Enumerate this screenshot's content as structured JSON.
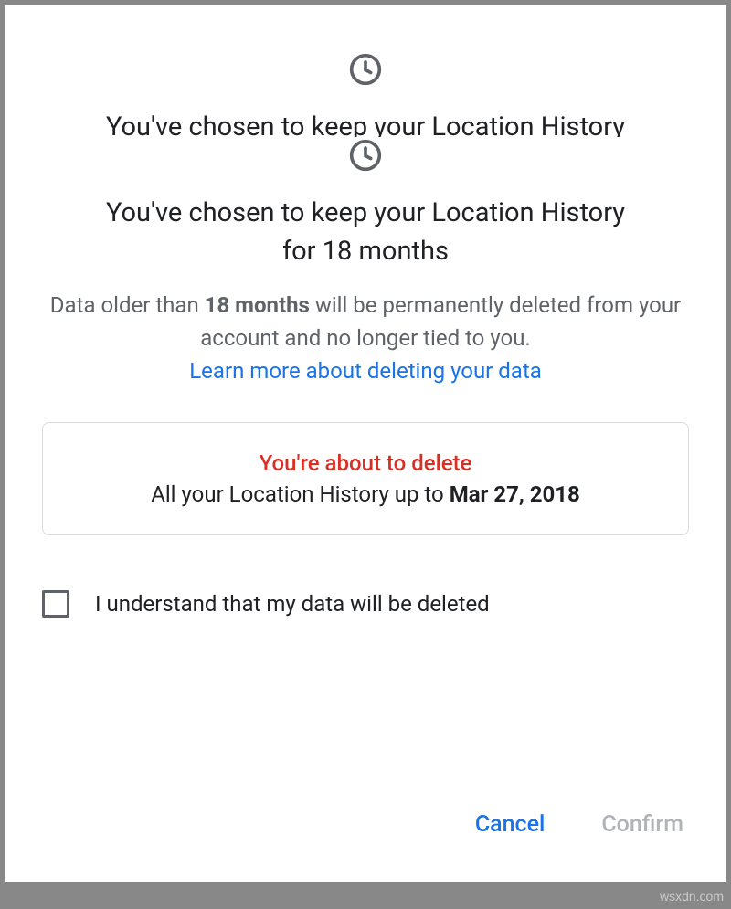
{
  "top": {
    "heading_line1": "You've chosen to keep your Location History",
    "heading_line2_partial": "for 18 months"
  },
  "main": {
    "heading_line1": "You've chosen to keep your Location History",
    "heading_line2": "for 18 months",
    "desc_pre": "Data older than ",
    "desc_bold": "18 months",
    "desc_post": " will be permanently deleted from your account and no longer tied to you.",
    "learn_more": "Learn more about deleting your data"
  },
  "warning": {
    "title": "You're about to delete",
    "body_pre": "All your Location History up to ",
    "body_date": "Mar 27, 2018"
  },
  "consent": {
    "label": "I understand that my data will be deleted",
    "checked": false
  },
  "actions": {
    "cancel": "Cancel",
    "confirm": "Confirm"
  },
  "watermark": "wsxdn.com",
  "icons": {
    "clock": "clock-icon"
  }
}
